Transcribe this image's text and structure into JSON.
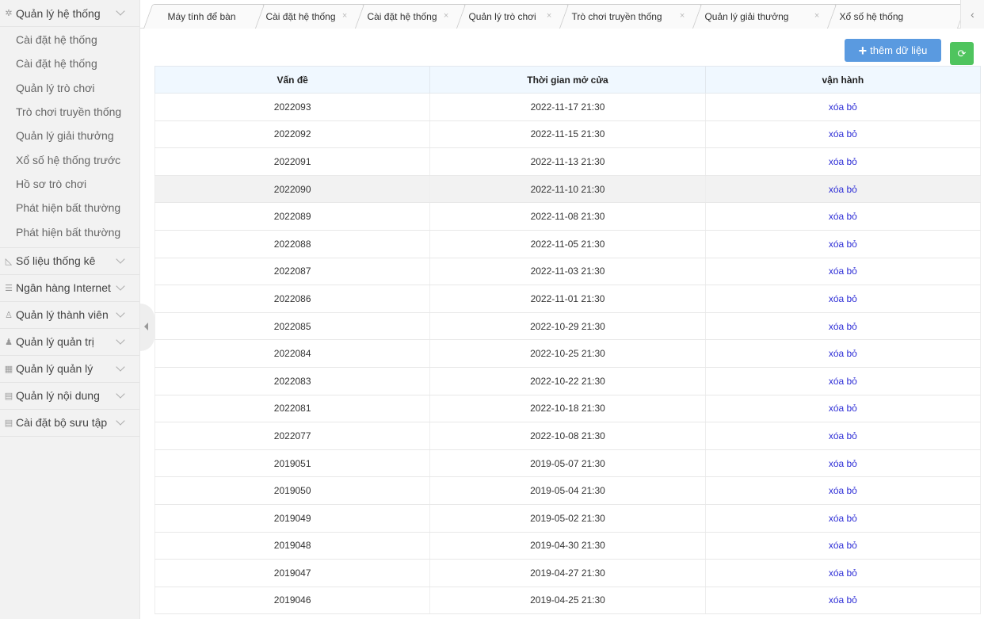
{
  "tabs": [
    {
      "label": "Máy tính để bàn",
      "closable": false
    },
    {
      "label": "Cài đặt hệ thống",
      "closable": true
    },
    {
      "label": "Cài đặt hệ thống",
      "closable": true
    },
    {
      "label": "Quản lý trò chơi",
      "closable": true
    },
    {
      "label": "Trò chơi truyền thống",
      "closable": true
    },
    {
      "label": "Quản lý giải thưởng",
      "closable": true
    },
    {
      "label": "Xổ số hệ thống",
      "closable": false
    }
  ],
  "tab_close_glyph": "×",
  "tab_scroll_glyph": "‹",
  "sidebar": {
    "groups": [
      {
        "label": "Quản lý hệ thống",
        "icon": "gear-icon",
        "glyph": "✲",
        "items": [
          "Cài đặt hệ thống",
          "Cài đặt hệ thống",
          "Quản lý trò chơi",
          "Trò chơi truyền thống",
          "Quản lý giải thưởng",
          "Xổ số hệ thống trước",
          "Hồ sơ trò chơi",
          "Phát hiện bất thường",
          "Phát hiện bất thường"
        ]
      },
      {
        "label": "Số liệu thống kê",
        "icon": "chart-icon",
        "glyph": "◺"
      },
      {
        "label": "Ngân hàng Internet",
        "icon": "list-icon",
        "glyph": "☰"
      },
      {
        "label": "Quản lý thành viên",
        "icon": "user-icon",
        "glyph": "♙"
      },
      {
        "label": "Quản lý quản trị",
        "icon": "admin-icon",
        "glyph": "♟"
      },
      {
        "label": "Quản lý quản lý",
        "icon": "grid-icon",
        "glyph": "▦"
      },
      {
        "label": "Quản lý nội dung",
        "icon": "document-icon",
        "glyph": "▤"
      },
      {
        "label": "Cài đặt bộ sưu tập",
        "icon": "collection-icon",
        "glyph": "▤"
      }
    ]
  },
  "toolbar": {
    "add_label": "thêm dữ liệu",
    "add_glyph": "+",
    "refresh_glyph": "⟳"
  },
  "table": {
    "headers": [
      "Vấn đề",
      "Thời gian mở cửa",
      "vận hành"
    ],
    "action_label": "xóa bỏ",
    "rows": [
      [
        "2022093",
        "2022-11-17 21:30"
      ],
      [
        "2022092",
        "2022-11-15 21:30"
      ],
      [
        "2022091",
        "2022-11-13 21:30"
      ],
      [
        "2022090",
        "2022-11-10 21:30"
      ],
      [
        "2022089",
        "2022-11-08 21:30"
      ],
      [
        "2022088",
        "2022-11-05 21:30"
      ],
      [
        "2022087",
        "2022-11-03 21:30"
      ],
      [
        "2022086",
        "2022-11-01 21:30"
      ],
      [
        "2022085",
        "2022-10-29 21:30"
      ],
      [
        "2022084",
        "2022-10-25 21:30"
      ],
      [
        "2022083",
        "2022-10-22 21:30"
      ],
      [
        "2022081",
        "2022-10-18 21:30"
      ],
      [
        "2022077",
        "2022-10-08 21:30"
      ],
      [
        "2019051",
        "2019-05-07 21:30"
      ],
      [
        "2019050",
        "2019-05-04 21:30"
      ],
      [
        "2019049",
        "2019-05-02 21:30"
      ],
      [
        "2019048",
        "2019-04-30 21:30"
      ],
      [
        "2019047",
        "2019-04-27 21:30"
      ],
      [
        "2019046",
        "2019-04-25 21:30"
      ]
    ],
    "highlighted_row_index": 3
  },
  "colors": {
    "add_button": "#5a9ae0",
    "refresh_button": "#4fc45e",
    "link": "#2d2dd6",
    "header_bg": "#f0f8ff"
  }
}
